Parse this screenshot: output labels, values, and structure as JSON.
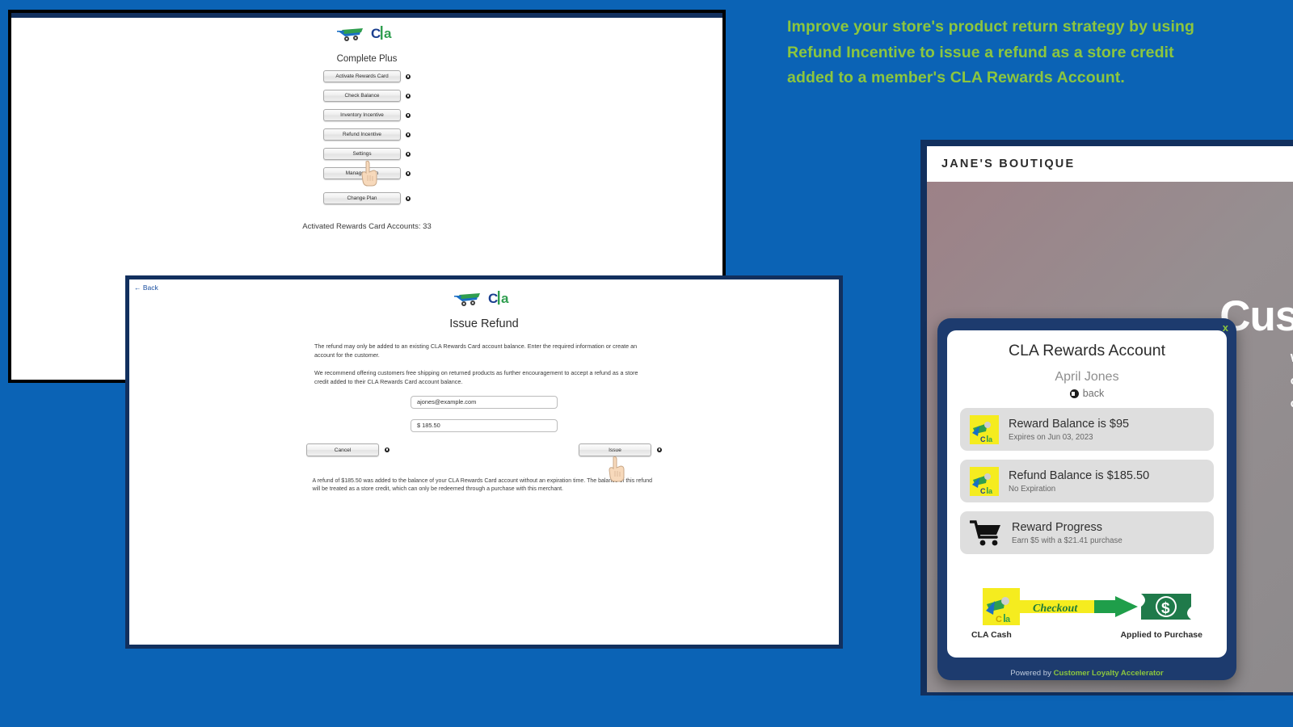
{
  "colors": {
    "page_background": "#0b63b5",
    "promo_green": "#8cc63e",
    "window_border_navy": "#12305e",
    "modal_navy": "#1d3b6e"
  },
  "dashboard": {
    "logo_text": "CLA",
    "plan_name": "Complete Plus",
    "buttons": [
      {
        "label": "Activate Rewards Card"
      },
      {
        "label": "Check Balance"
      },
      {
        "label": "Inventory Incentive"
      },
      {
        "label": "Refund Incentive"
      },
      {
        "label": "Settings"
      },
      {
        "label": "Manage Login"
      },
      {
        "label": "Change Plan"
      }
    ],
    "footnote": "Activated Rewards Card Accounts: 33"
  },
  "refund_window": {
    "back_label": "← Back",
    "logo_text": "CLA",
    "title": "Issue Refund",
    "paragraph_1": "The refund may only be added to an existing CLA Rewards Card account balance. Enter the required information or create an account for the customer.",
    "paragraph_2": "We recommend offering customers free shipping on returned products as further encouragement to accept a refund as a store credit added to their CLA Rewards Card account balance.",
    "email_value": "ajones@example.com",
    "email_placeholder": "ajones@example.com",
    "amount_value": "$ 185.50",
    "amount_placeholder": "$ 185.50",
    "cancel_label": "Cancel",
    "issue_label": "Issue",
    "confirmation": "A refund of $185.50 was added to the balance of your CLA Rewards Card account without an expiration time. The balance of this refund will be treated as a store credit, which can only be redeemed through a purchase with this merchant."
  },
  "promo": {
    "headline": "Improve your store's product return strategy by using Refund Incentive to issue a refund as a store credit added to a member's CLA Rewards Account."
  },
  "storefront": {
    "brand": "JANE'S BOUTIQUE",
    "hero_title": "Cust",
    "hero_sub": "We\nog\ncr"
  },
  "rewards_modal": {
    "close_label": "x",
    "title": "CLA Rewards Account",
    "user_name": "April Jones",
    "back_label": "back",
    "rows": [
      {
        "main": "Reward Balance is $95",
        "sub": "Expires on Jun 03, 2023",
        "icon": "cla-card-icon"
      },
      {
        "main": "Refund Balance is $185.50",
        "sub": "No Expiration",
        "icon": "cla-card-icon"
      },
      {
        "main": "Reward Progress",
        "sub": "Earn $5 with a $21.41 purchase",
        "icon": "shopping-cart-icon"
      }
    ],
    "flow": {
      "arrow_label": "Checkout",
      "left_label": "CLA Cash",
      "right_label": "Applied to Purchase"
    },
    "footer_prefix": "Powered by ",
    "footer_brand": "Customer Loyalty Accelerator"
  }
}
